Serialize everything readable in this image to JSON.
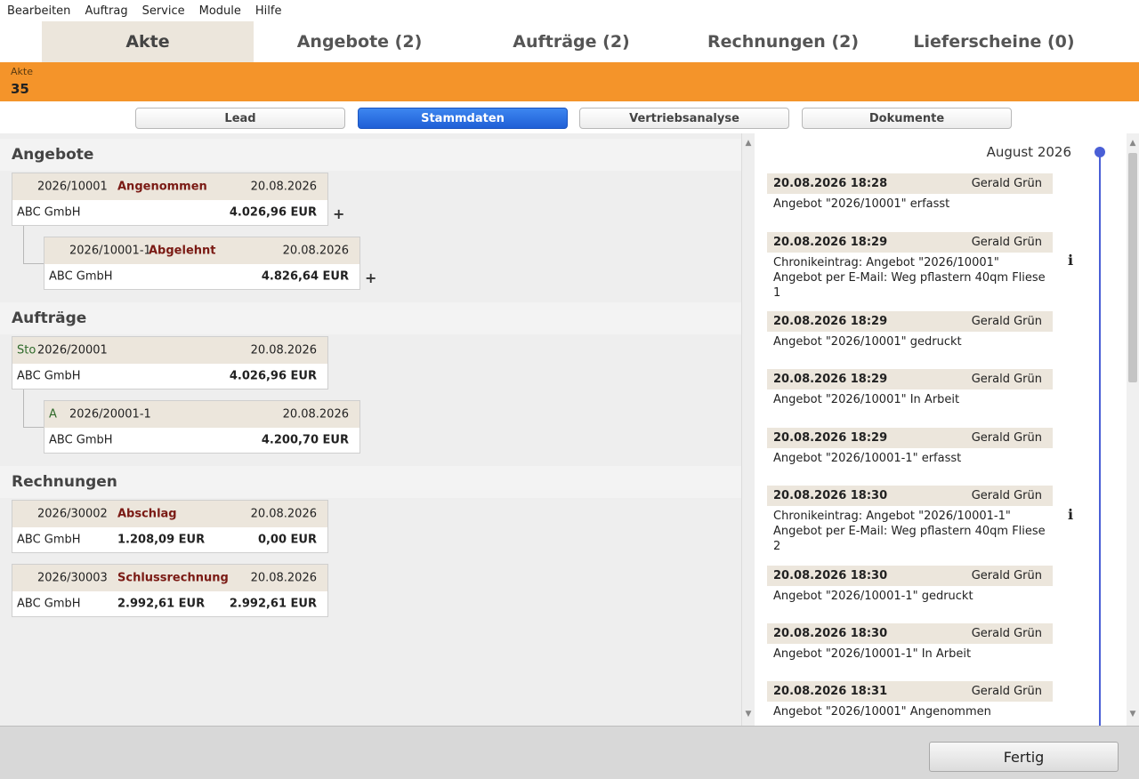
{
  "menu": [
    "Bearbeiten",
    "Auftrag",
    "Service",
    "Module",
    "Hilfe"
  ],
  "tabs": [
    "Akte",
    "Angebote (2)",
    "Aufträge (2)",
    "Rechnungen (2)",
    "Lieferscheine (0)"
  ],
  "header": {
    "label": "Akte",
    "number": "35",
    "accent": "#f4942a"
  },
  "subtabs": [
    "Lead",
    "Stammdaten",
    "Vertriebsanalyse",
    "Dokumente"
  ],
  "sections": {
    "angebote": {
      "title": "Angebote",
      "c1": {
        "number": "2026/10001",
        "status": "Angenommen",
        "date": "20.08.2026",
        "customer": "ABC GmbH",
        "amount": "4.026,96 EUR"
      },
      "c2": {
        "number": "2026/10001-1",
        "status": "Abgelehnt",
        "date": "20.08.2026",
        "customer": "ABC GmbH",
        "amount": "4.826,64 EUR"
      }
    },
    "auftraege": {
      "title": "Aufträge",
      "c1": {
        "prefix": "Sto",
        "number": "2026/20001",
        "date": "20.08.2026",
        "customer": "ABC GmbH",
        "amount": "4.026,96 EUR"
      },
      "c2": {
        "prefix": "A",
        "number": "2026/20001-1",
        "date": "20.08.2026",
        "customer": "ABC GmbH",
        "amount": "4.200,70 EUR"
      }
    },
    "rechnungen": {
      "title": "Rechnungen",
      "c1": {
        "number": "2026/30002",
        "status": "Abschlag",
        "date": "20.08.2026",
        "customer": "ABC GmbH",
        "amount": "1.208,09 EUR",
        "open": "0,00 EUR"
      },
      "c2": {
        "number": "2026/30003",
        "status": "Schlussrechnung",
        "date": "20.08.2026",
        "customer": "ABC GmbH",
        "amount": "2.992,61 EUR",
        "open": "2.992,61 EUR"
      }
    }
  },
  "plus": "+",
  "timeline": {
    "month": "August 2026",
    "info_icon": "ℹ",
    "entries": [
      {
        "datetime": "20.08.2026 18:28",
        "user": "Gerald Grün",
        "lines": [
          "Angebot \"2026/10001\" erfasst"
        ]
      },
      {
        "datetime": "20.08.2026 18:29",
        "user": "Gerald Grün",
        "lines": [
          "Chronikeintrag: Angebot \"2026/10001\"",
          "Angebot per E-Mail: Weg pflastern 40qm Fliese",
          "1"
        ]
      },
      {
        "datetime": "20.08.2026 18:29",
        "user": "Gerald Grün",
        "lines": [
          "Angebot \"2026/10001\" gedruckt"
        ]
      },
      {
        "datetime": "20.08.2026 18:29",
        "user": "Gerald Grün",
        "lines": [
          "Angebot \"2026/10001\" In Arbeit"
        ]
      },
      {
        "datetime": "20.08.2026 18:29",
        "user": "Gerald Grün",
        "lines": [
          "Angebot \"2026/10001-1\" erfasst"
        ]
      },
      {
        "datetime": "20.08.2026 18:30",
        "user": "Gerald Grün",
        "lines": [
          "Chronikeintrag: Angebot \"2026/10001-1\"",
          "Angebot per E-Mail: Weg pflastern 40qm Fliese",
          "2"
        ]
      },
      {
        "datetime": "20.08.2026 18:30",
        "user": "Gerald Grün",
        "lines": [
          "Angebot \"2026/10001-1\" gedruckt"
        ]
      },
      {
        "datetime": "20.08.2026 18:30",
        "user": "Gerald Grün",
        "lines": [
          "Angebot \"2026/10001-1\" In Arbeit"
        ]
      },
      {
        "datetime": "20.08.2026 18:31",
        "user": "Gerald Grün",
        "lines": [
          "Angebot \"2026/10001\" Angenommen"
        ]
      }
    ]
  },
  "footer": {
    "done_label": "Fertig"
  }
}
